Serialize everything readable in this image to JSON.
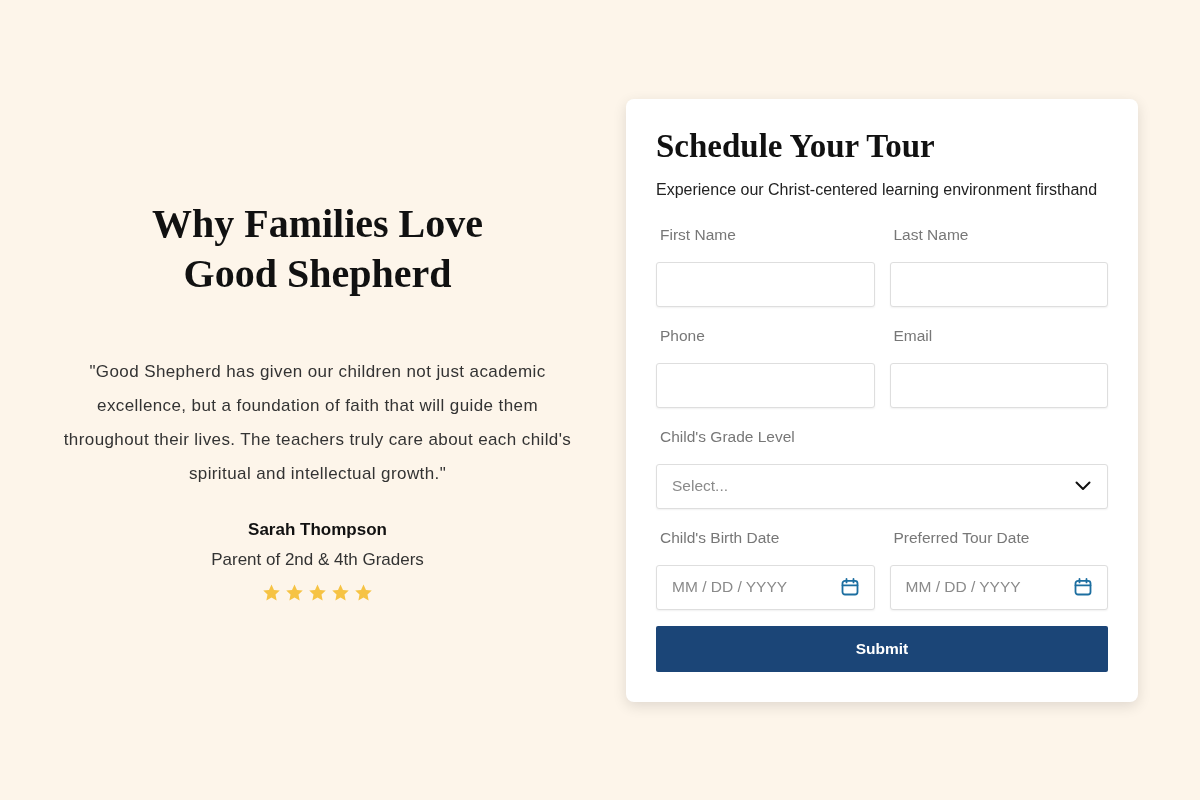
{
  "testimonial": {
    "heading": "Why Families Love Good Shepherd",
    "quote": "\"Good Shepherd has given our children not just academic excellence, but a foundation of faith that will guide them throughout their lives. The teachers truly care about each child's spiritual and intellectual growth.\"",
    "author": "Sarah Thompson",
    "role": "Parent of 2nd & 4th Graders",
    "stars": 5
  },
  "form": {
    "title": "Schedule Your Tour",
    "subtitle": "Experience our Christ-centered learning environment firsthand",
    "rows": [
      [
        {
          "label": "First Name",
          "kind": "text"
        },
        {
          "label": "Last Name",
          "kind": "text"
        }
      ],
      [
        {
          "label": "Phone",
          "kind": "text"
        },
        {
          "label": "Email",
          "kind": "text"
        }
      ],
      [
        {
          "label": "Child's Grade Level",
          "kind": "select",
          "placeholder": "Select..."
        }
      ],
      [
        {
          "label": "Child's Birth Date",
          "kind": "date",
          "placeholder": "MM / DD / YYYY"
        },
        {
          "label": "Preferred Tour Date",
          "kind": "date",
          "placeholder": "MM / DD / YYYY"
        }
      ]
    ],
    "submit": "Submit"
  }
}
